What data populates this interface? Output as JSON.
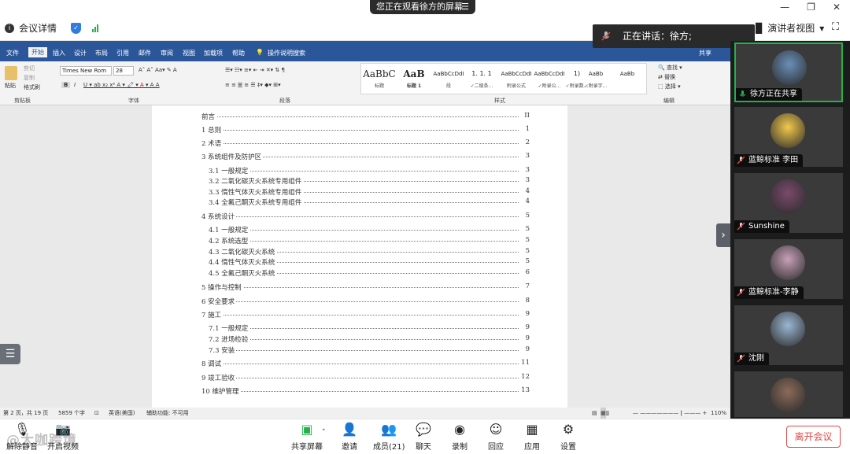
{
  "banner": {
    "text": "您正在观看徐方的屏幕",
    "menu_glyph": "☰"
  },
  "meeting_info": {
    "label": "会议详情",
    "info_glyph": "i",
    "shield_glyph": "✓"
  },
  "window": {
    "minimize": "—",
    "restore": "❐",
    "close": "✕"
  },
  "view": {
    "label": "演讲者视图",
    "layout_glyph": "▉",
    "chevron": "▾",
    "fullscreen_glyph": "⛶"
  },
  "speaking": {
    "label": "正在讲话：徐方;"
  },
  "word": {
    "tabs": [
      "文件",
      "开始",
      "插入",
      "设计",
      "布局",
      "引用",
      "邮件",
      "审阅",
      "视图",
      "加载项",
      "帮助",
      "操作说明搜索"
    ],
    "share": "共享",
    "clipboard": {
      "paste": "粘贴",
      "cut": "剪切",
      "copy": "复制",
      "format_painter": "格式刷",
      "group": "剪贴板"
    },
    "font": {
      "name": "Times New Rom",
      "size": "28",
      "group": "字体"
    },
    "paragraph_group": "段落",
    "styles": [
      {
        "preview": "AaBbC",
        "label": "标题"
      },
      {
        "preview": "AaB",
        "label": "标题 1"
      },
      {
        "preview": "AaBbCcDdI",
        "label": "段"
      },
      {
        "preview": "1. 1. 1",
        "label": "✓二级条..."
      },
      {
        "preview": "AaBbCcDdI",
        "label": "附录公式"
      },
      {
        "preview": "AaBbCcDdI",
        "label": "✓附录公..."
      },
      {
        "preview": "1)",
        "label": "✓附录数..."
      },
      {
        "preview": "AaBb",
        "label": "✓附录字..."
      },
      {
        "preview": "AaBb",
        "label": ""
      }
    ],
    "styles_group": "样式",
    "edit": {
      "find": "查找",
      "replace": "替换",
      "select": "选择",
      "group": "编辑"
    },
    "toc": [
      {
        "title": "前言",
        "page": "II",
        "indent": 0
      },
      {
        "title": "1 总则",
        "page": "1",
        "indent": 0
      },
      {
        "title": "2 术语",
        "page": "2",
        "indent": 0
      },
      {
        "title": "3 系统组件及防护区",
        "page": "3",
        "indent": 0
      },
      {
        "title": "3.1 一般规定",
        "page": "3",
        "indent": 1
      },
      {
        "title": "3.2 二氧化碳灭火系统专用组件",
        "page": "3",
        "indent": 1
      },
      {
        "title": "3.3 惰性气体灭火系统专用组件",
        "page": "4",
        "indent": 1
      },
      {
        "title": "3.4 全氟己酮灭火系统专用组件",
        "page": "4",
        "indent": 1
      },
      {
        "title": "4 系统设计",
        "page": "5",
        "indent": 0
      },
      {
        "title": "4.1 一般规定",
        "page": "5",
        "indent": 1
      },
      {
        "title": "4.2 系统选型",
        "page": "5",
        "indent": 1
      },
      {
        "title": "4.3 二氧化碳灭火系统",
        "page": "5",
        "indent": 1
      },
      {
        "title": "4.4 惰性气体灭火系统",
        "page": "5",
        "indent": 1
      },
      {
        "title": "4.5 全氟己酮灭火系统",
        "page": "6",
        "indent": 1
      },
      {
        "title": "5 操作与控制",
        "page": "7",
        "indent": 0
      },
      {
        "title": "6 安全要求",
        "page": "8",
        "indent": 0
      },
      {
        "title": "7 施工",
        "page": "9",
        "indent": 0
      },
      {
        "title": "7.1 一般规定",
        "page": "9",
        "indent": 1
      },
      {
        "title": "7.2 进场检验",
        "page": "9",
        "indent": 1
      },
      {
        "title": "7.3 安装",
        "page": "9",
        "indent": 1
      },
      {
        "title": "8 调试",
        "page": "11",
        "indent": 0
      },
      {
        "title": "9 竣工验收",
        "page": "12",
        "indent": 0
      },
      {
        "title": "10 维护管理",
        "page": "13",
        "indent": 0
      }
    ],
    "status": {
      "page": "第 2 页，共 19 页",
      "words": "5859 个字",
      "language": "英语(美国)",
      "accessibility": "辅助功能: 不可用",
      "zoom": "110%"
    }
  },
  "side_menu_glyph": "☰",
  "next_glyph": "›",
  "participants": [
    {
      "name": "徐方正在共享",
      "active": true,
      "color": "#6a8fb8",
      "muted": false
    },
    {
      "name": "蓝鲸标准 李田",
      "active": false,
      "color": "#f2c94c",
      "muted": true
    },
    {
      "name": "Sunshine",
      "active": false,
      "color": "#7a4a6b",
      "muted": true
    },
    {
      "name": "蓝鲸标准-李静",
      "active": false,
      "color": "#c7a0b8",
      "muted": true
    },
    {
      "name": "沈刚",
      "active": false,
      "color": "#9bb7d4",
      "muted": true
    },
    {
      "name": "",
      "active": false,
      "color": "#8b6b5a",
      "muted": false
    }
  ],
  "toolbar": {
    "mute": "解除静音",
    "video": "开启视频",
    "share": "共享屏幕",
    "invite": "邀请",
    "members": "成员(21)",
    "chat": "聊天",
    "record": "录制",
    "reactions": "回应",
    "apps": "应用",
    "settings": "设置",
    "leave": "离开会议"
  },
  "watermark": "@大咖跨境"
}
